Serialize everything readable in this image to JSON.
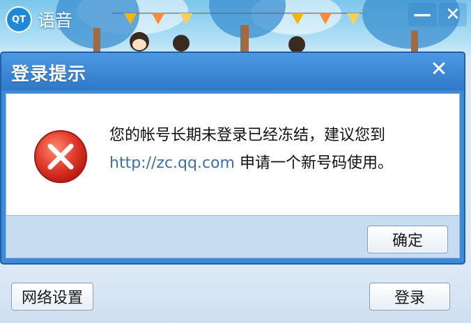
{
  "app": {
    "title": "语音",
    "logo_text": "QT"
  },
  "window_controls": {
    "minimize_glyph": "—",
    "close_glyph": "✕"
  },
  "dialog": {
    "title": "登录提示",
    "close_glyph": "✕",
    "message_part1": "您的帐号长期未登录已经冻结，建议您到",
    "message_link": "http://zc.qq.com",
    "message_part2": " 申请一个新号码使用。",
    "confirm_label": "确定",
    "icon": "error-icon"
  },
  "bottom_bar": {
    "network_settings_label": "网络设置",
    "login_label": "登录"
  },
  "colors": {
    "dialog_frame": "#3f8ad6",
    "titlebar": "#2f79c8",
    "footer": "#c8dcf1",
    "error_red": "#e03a2a"
  }
}
